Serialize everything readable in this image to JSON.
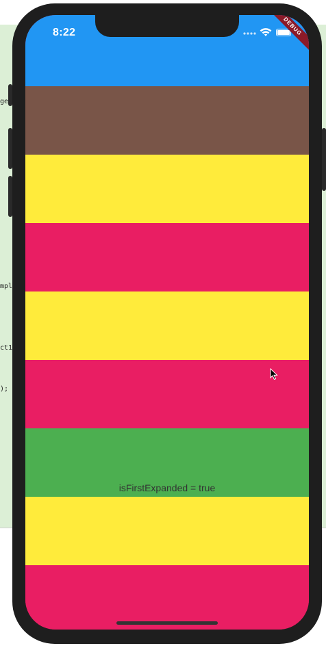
{
  "status_bar": {
    "time": "8:22",
    "battery_level": 1.0
  },
  "debug_banner": "DEBUG",
  "bands": [
    {
      "color": "#2196f3"
    },
    {
      "color": "#795548"
    },
    {
      "color": "#ffeb3b"
    },
    {
      "color": "#e91e63"
    },
    {
      "color": "#ffeb3b"
    },
    {
      "color": "#e91e63"
    },
    {
      "color": "#4caf50"
    },
    {
      "color": "#ffeb3b"
    },
    {
      "color": "#e91e63"
    }
  ],
  "center_label": "isFirstExpanded = true",
  "editor_fragments": [
    "ge",
    "mpl",
    "ct1",
    ");"
  ],
  "icons": {
    "wifi": "wifi-icon",
    "battery": "battery-icon",
    "cursor": "mouse-pointer-icon"
  }
}
